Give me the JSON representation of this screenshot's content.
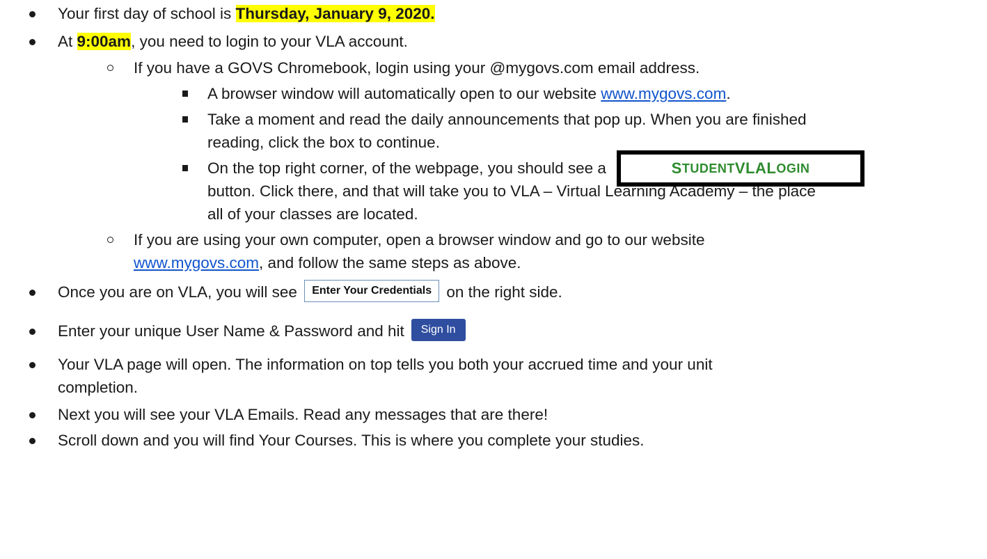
{
  "items": {
    "first_day_pre": "Your first day of school is ",
    "first_day_date": "Thursday, January 9, 2020.",
    "login_pre": "At ",
    "login_time": "9:00am",
    "login_post": ", you need to login to your VLA account.",
    "chromebook": "If you have a GOVS Chromebook, login using your @mygovs.com email address.",
    "browser_pre": "A browser window will automatically open to our website ",
    "website_link": "www.mygovs.com",
    "browser_post": ".",
    "announce_1": "Take a moment and read the daily announcements that pop up.  When you are finished",
    "announce_2": "reading, click the box to continue.",
    "corner_1": "On the top right corner, of the webpage, you should see a",
    "student_btn_a": "S",
    "student_btn_b": "TUDENT ",
    "student_btn_c": "VLA",
    "student_btn_d": " L",
    "student_btn_e": "OGIN",
    "corner_2": "button.  Click there, and that will take you to VLA – Virtual Learning Academy – the place",
    "corner_3": "all of your classes are located.",
    "own_1": "If you are using your own computer, open a browser window and go to our website",
    "own_link": "www.mygovs.com",
    "own_2": ", and follow the same steps as above.",
    "vla_pre": "Once you are on VLA, you will see",
    "credentials_btn": "Enter Your Credentials",
    "vla_post": "on the right side.",
    "enter_pre": "Enter your unique User Name & Password and hit",
    "signin_btn": "Sign In",
    "page_1": "Your VLA page will open.  The information on top tells you both your accrued time and your unit",
    "page_2": "completion.",
    "emails": "Next you will see your VLA Emails.  Read any messages that are there!",
    "courses": "Scroll down and you will find Your Courses.  This is where you complete your studies."
  }
}
